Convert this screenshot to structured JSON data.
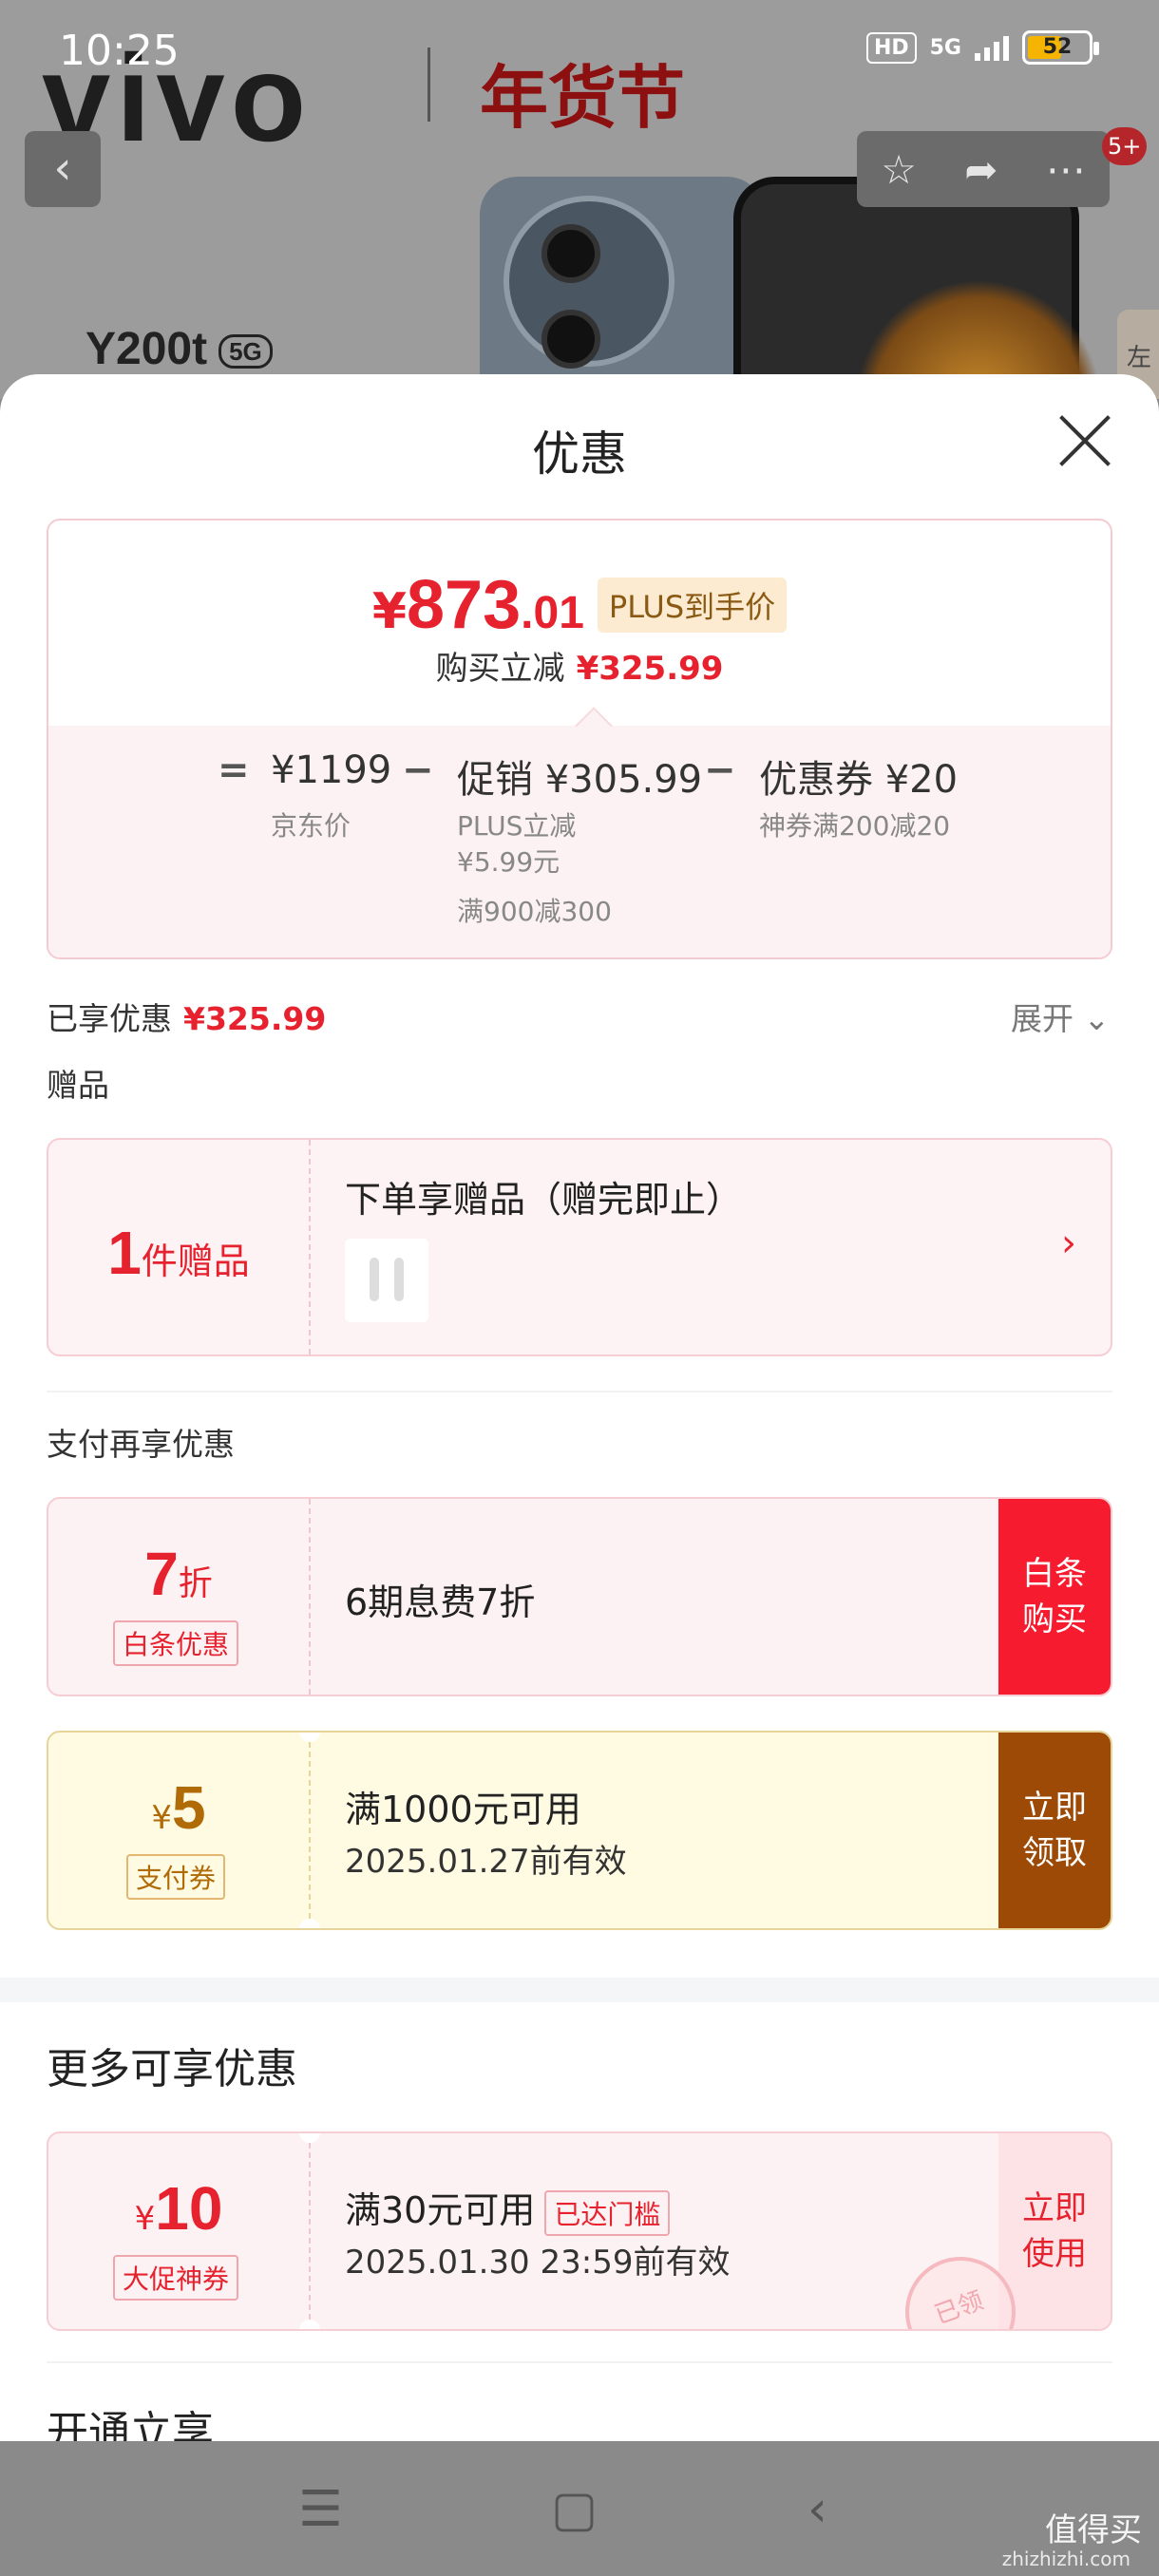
{
  "status_bar": {
    "time": "10:25",
    "hd": "HD",
    "network": "5G",
    "battery": "52"
  },
  "background": {
    "brand": "vivo",
    "festival": "年货节",
    "model": "Y200t",
    "model_badge": "5G",
    "side_tab": "左"
  },
  "notification_badge": "5+",
  "sheet": {
    "title": "优惠",
    "price": {
      "currency": "¥",
      "integer": "873",
      "decimal": ".01",
      "tag": "PLUS到手价"
    },
    "reduce": {
      "label": "购买立减",
      "amount": "¥325.99"
    },
    "calc": {
      "jd_price": "¥1199",
      "jd_price_label": "京东价",
      "promo_label": "促销",
      "promo_value": "¥305.99",
      "promo_detail_1": "PLUS立减",
      "promo_detail_2": "¥5.99元",
      "promo_detail_3": "满900减300",
      "coupon_label": "优惠券",
      "coupon_value": "¥20",
      "coupon_detail": "神券满200减20",
      "eq": "=",
      "minus": "−"
    },
    "enjoyed": {
      "label": "已享优惠",
      "amount": "¥325.99"
    },
    "expand": "展开",
    "gift_section": "赠品",
    "gift": {
      "count": "1",
      "unit": "件赠品",
      "title": "下单享赠品（赠完即止）"
    },
    "pay_section": "支付再享优惠",
    "baitiao": {
      "discount": "7",
      "unit": "折",
      "chip": "白条优惠",
      "text": "6期息费7折",
      "action_1": "白条",
      "action_2": "购买"
    },
    "pay_coupon": {
      "currency": "¥",
      "amount": "5",
      "chip": "支付券",
      "line1": "满1000元可用",
      "line2": "2025.01.27前有效",
      "action_1": "立即",
      "action_2": "领取"
    },
    "more_title": "更多可享优惠",
    "promo_coupon": {
      "currency": "¥",
      "amount": "10",
      "chip": "大促神券",
      "line1": "满30元可用",
      "threshold_chip": "已达门槛",
      "line2": "2025.01.30 23:59前有效",
      "action_1": "立即",
      "action_2": "使用",
      "stamp": "已领"
    },
    "next_section": "开通立享"
  },
  "watermark": {
    "text": "值得买",
    "url": "zhizhizhi.com"
  }
}
